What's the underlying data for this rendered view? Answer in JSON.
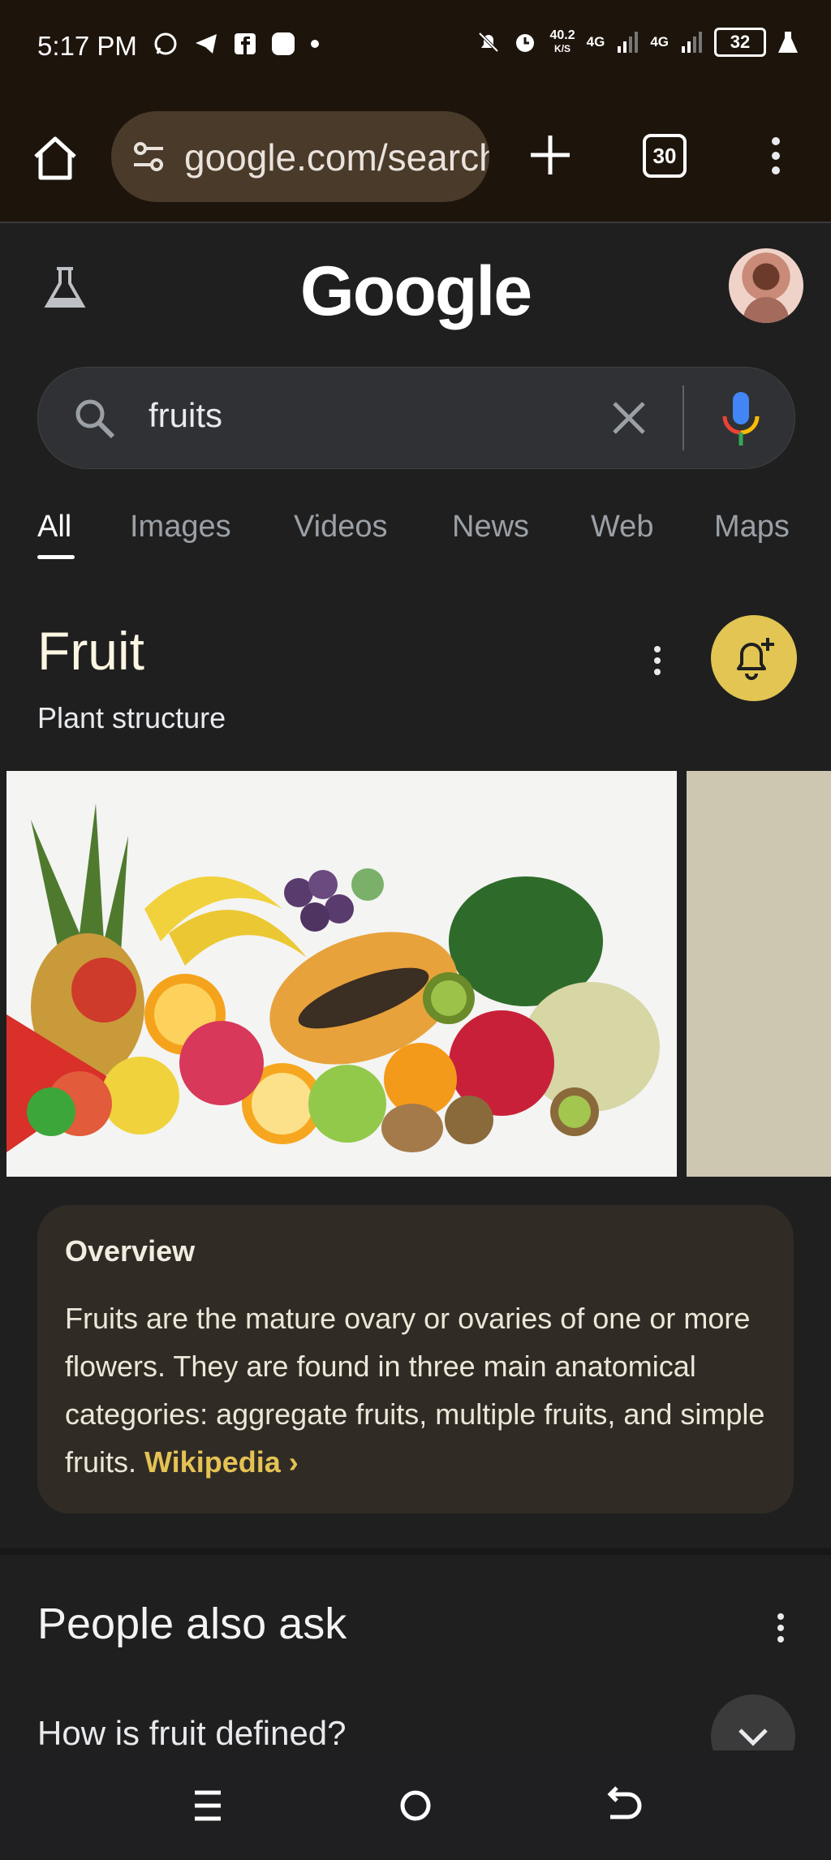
{
  "status_bar": {
    "time": "5:17 PM",
    "net_speed_top": "40.2",
    "net_speed_unit": "K/S",
    "network1": "4G",
    "network2": "4G",
    "battery": "32"
  },
  "browser": {
    "url": "google.com/search?q=fruits",
    "tab_count": "30"
  },
  "google": {
    "logo_text": "Google",
    "search_query": "fruits",
    "tabs": [
      "All",
      "Images",
      "Videos",
      "News",
      "Web",
      "Maps"
    ]
  },
  "knowledge_panel": {
    "title": "Fruit",
    "subtitle": "Plant structure"
  },
  "overview": {
    "heading": "Overview",
    "text": "Fruits are the mature ovary or ovaries of one or more flowers. They are found in three main anatomical categories: aggregate fruits, multiple fruits, and simple fruits. ",
    "link_label": "Wikipedia ›"
  },
  "people_also_ask": {
    "title": "People also ask",
    "question_1": "How is fruit defined?"
  },
  "colors": {
    "accent_yellow": "#e2c553",
    "link_yellow": "#e5c254",
    "background": "#1f1f1f"
  }
}
